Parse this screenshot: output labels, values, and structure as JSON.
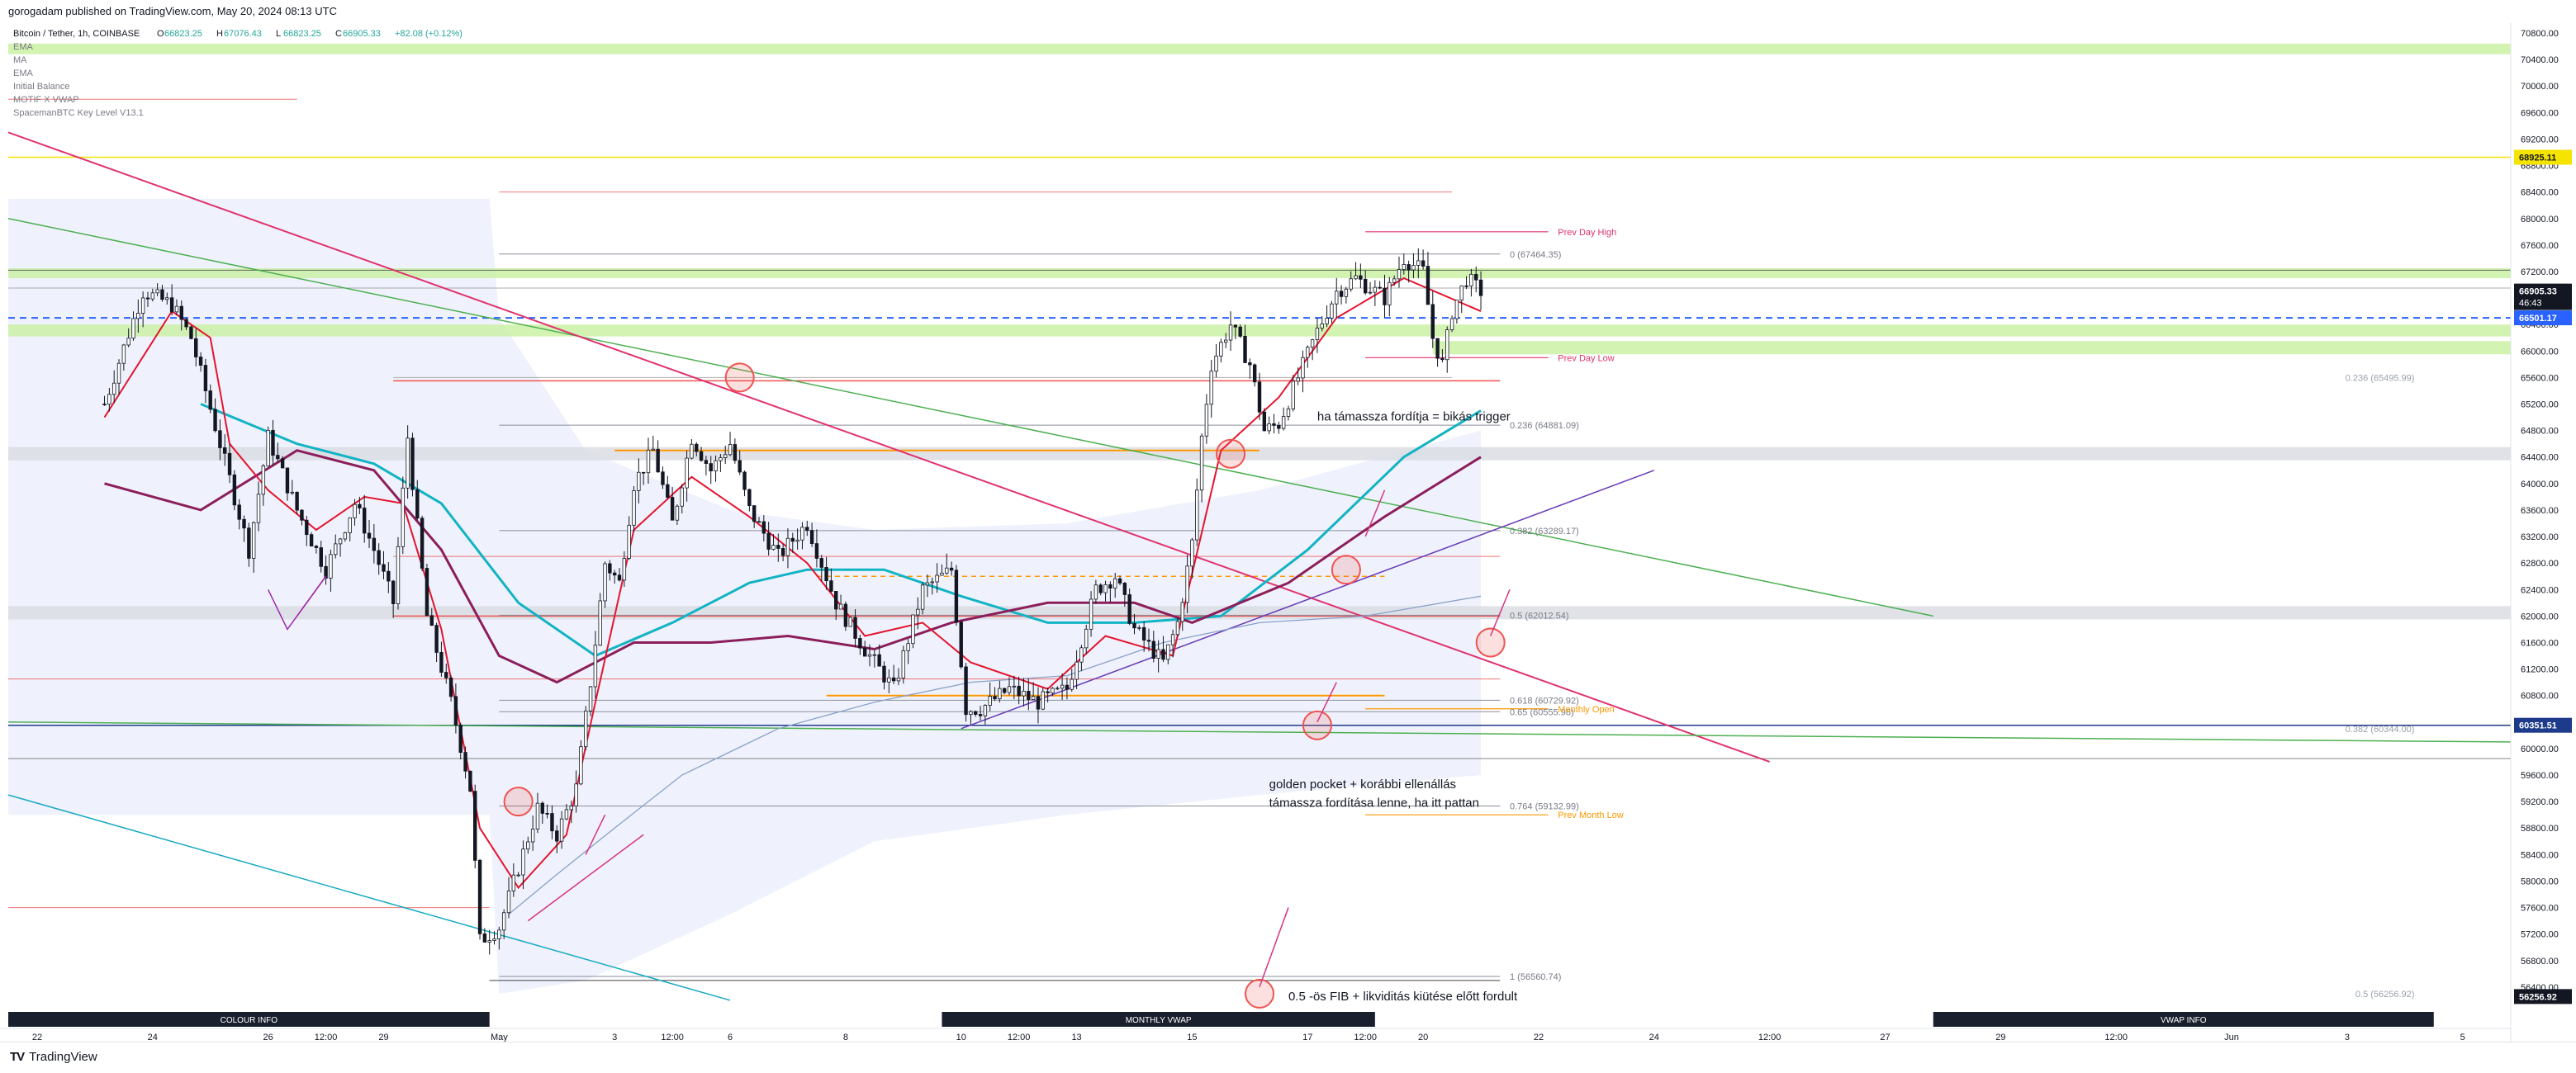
{
  "header": {
    "published": "gorogadam published on TradingView.com, May 20, 2024 08:13 UTC"
  },
  "footer": {
    "logo_glyph": "TV",
    "brand": "TradingView"
  },
  "colors": {
    "up": "#26a69a",
    "down": "#ef5350",
    "ema_red": "#e5132e",
    "ma_purple": "#8b1e5b",
    "cyan": "#12b3c4",
    "green_zone": "#c8f0a0",
    "gray_zone": "#dadde3",
    "pink_trend": "#e0336e",
    "green_trend": "#4caf50",
    "violet_trend": "#673ab7",
    "teal_trend": "#17a9c2",
    "yellow_line": "#f5e300",
    "orange_line": "#ff9800",
    "blue_line": "#1e3a8a",
    "dashed_blue": "#2962ff",
    "vwap_band": "#e9eefb"
  },
  "chart_data": {
    "type": "candlestick",
    "title": "Bitcoin / Tether, 1h, COINBASE",
    "ohlc": {
      "o": "66823.25",
      "h": "67076.43",
      "l": "66823.25",
      "c": "66905.33",
      "chg": "+82.08 (+0.12%)"
    },
    "indicators": [
      "EMA",
      "MA",
      "EMA",
      "Initial Balance",
      "MOTIF X VWAP",
      "SpacemanBTC Key Level V13.1"
    ],
    "y_range": [
      56000,
      70800
    ],
    "y_ticks": [
      "70800.00",
      "70400.00",
      "70000.00",
      "69600.00",
      "69200.00",
      "68800.00",
      "68400.00",
      "68000.00",
      "67600.00",
      "67200.00",
      "66800.00",
      "66400.00",
      "66000.00",
      "65600.00",
      "65200.00",
      "64800.00",
      "64400.00",
      "64000.00",
      "63600.00",
      "63200.00",
      "62800.00",
      "62400.00",
      "62000.00",
      "61600.00",
      "61200.00",
      "60800.00",
      "60400.00",
      "60000.00",
      "59600.00",
      "59200.00",
      "58800.00",
      "58400.00",
      "58000.00",
      "57600.00",
      "57200.00",
      "56800.00",
      "56400.00"
    ],
    "x_ticks": [
      {
        "t": -14,
        "label": "22"
      },
      {
        "t": 10,
        "label": "24"
      },
      {
        "t": 34,
        "label": "26"
      },
      {
        "t": 46,
        "label": "12:00"
      },
      {
        "t": 58,
        "label": "29"
      },
      {
        "t": 82,
        "label": "May"
      },
      {
        "t": 106,
        "label": "3"
      },
      {
        "t": 118,
        "label": "12:00"
      },
      {
        "t": 130,
        "label": "6"
      },
      {
        "t": 154,
        "label": "8"
      },
      {
        "t": 178,
        "label": "10"
      },
      {
        "t": 190,
        "label": "12:00"
      },
      {
        "t": 202,
        "label": "13"
      },
      {
        "t": 226,
        "label": "15"
      },
      {
        "t": 250,
        "label": "17"
      },
      {
        "t": 262,
        "label": "12:00"
      },
      {
        "t": 274,
        "label": "20"
      },
      {
        "t": 298,
        "label": "22"
      },
      {
        "t": 322,
        "label": "24"
      },
      {
        "t": 346,
        "label": "12:00"
      },
      {
        "t": 370,
        "label": "27"
      },
      {
        "t": 394,
        "label": "29"
      },
      {
        "t": 418,
        "label": "12:00"
      },
      {
        "t": 442,
        "label": "Jun"
      },
      {
        "t": 466,
        "label": "3"
      },
      {
        "t": 490,
        "label": "5"
      }
    ],
    "price_path": [
      [
        0,
        65200
      ],
      [
        8,
        66900
      ],
      [
        14,
        66700
      ],
      [
        18,
        66200
      ],
      [
        24,
        64600
      ],
      [
        30,
        63000
      ],
      [
        34,
        64700
      ],
      [
        40,
        63600
      ],
      [
        46,
        62700
      ],
      [
        52,
        63700
      ],
      [
        56,
        63000
      ],
      [
        60,
        62200
      ],
      [
        63,
        64700
      ],
      [
        67,
        62000
      ],
      [
        72,
        60700
      ],
      [
        76,
        59400
      ],
      [
        78,
        57100
      ],
      [
        82,
        57300
      ],
      [
        86,
        58200
      ],
      [
        90,
        59100
      ],
      [
        94,
        58700
      ],
      [
        98,
        59400
      ],
      [
        101,
        61000
      ],
      [
        104,
        62800
      ],
      [
        107,
        62500
      ],
      [
        110,
        64000
      ],
      [
        114,
        64500
      ],
      [
        118,
        63400
      ],
      [
        122,
        64700
      ],
      [
        126,
        64200
      ],
      [
        130,
        64600
      ],
      [
        134,
        63600
      ],
      [
        140,
        62900
      ],
      [
        146,
        63400
      ],
      [
        152,
        62200
      ],
      [
        158,
        61500
      ],
      [
        164,
        60900
      ],
      [
        170,
        62400
      ],
      [
        176,
        62700
      ],
      [
        179,
        60600
      ],
      [
        182,
        60600
      ],
      [
        188,
        60900
      ],
      [
        194,
        60700
      ],
      [
        200,
        60900
      ],
      [
        206,
        62400
      ],
      [
        210,
        62600
      ],
      [
        214,
        61800
      ],
      [
        220,
        61300
      ],
      [
        223,
        61900
      ],
      [
        226,
        63100
      ],
      [
        228,
        64700
      ],
      [
        230,
        65800
      ],
      [
        234,
        66400
      ],
      [
        238,
        65800
      ],
      [
        241,
        64800
      ],
      [
        244,
        64900
      ],
      [
        248,
        65600
      ],
      [
        252,
        66300
      ],
      [
        256,
        66900
      ],
      [
        260,
        67100
      ],
      [
        266,
        66800
      ],
      [
        270,
        67400
      ],
      [
        274,
        67200
      ],
      [
        276,
        66200
      ],
      [
        278,
        65800
      ],
      [
        280,
        66600
      ],
      [
        283,
        67100
      ],
      [
        286,
        66900
      ]
    ],
    "ema_red": [
      [
        0,
        65000
      ],
      [
        14,
        66600
      ],
      [
        22,
        66200
      ],
      [
        26,
        64600
      ],
      [
        34,
        63900
      ],
      [
        44,
        63300
      ],
      [
        54,
        63800
      ],
      [
        62,
        63700
      ],
      [
        70,
        61800
      ],
      [
        78,
        58800
      ],
      [
        86,
        57900
      ],
      [
        96,
        58700
      ],
      [
        102,
        60700
      ],
      [
        110,
        63300
      ],
      [
        122,
        64100
      ],
      [
        134,
        63500
      ],
      [
        146,
        62800
      ],
      [
        158,
        61700
      ],
      [
        170,
        61900
      ],
      [
        180,
        61300
      ],
      [
        196,
        60900
      ],
      [
        208,
        61700
      ],
      [
        222,
        61400
      ],
      [
        232,
        64500
      ],
      [
        244,
        65300
      ],
      [
        256,
        66500
      ],
      [
        270,
        67100
      ],
      [
        286,
        66600
      ]
    ],
    "ma_purple": [
      [
        0,
        64000
      ],
      [
        20,
        63600
      ],
      [
        40,
        64500
      ],
      [
        56,
        64200
      ],
      [
        70,
        63000
      ],
      [
        82,
        61400
      ],
      [
        94,
        61000
      ],
      [
        110,
        61600
      ],
      [
        126,
        61600
      ],
      [
        142,
        61700
      ],
      [
        160,
        61500
      ],
      [
        176,
        61900
      ],
      [
        196,
        62200
      ],
      [
        214,
        62200
      ],
      [
        226,
        61900
      ],
      [
        246,
        62500
      ],
      [
        266,
        63500
      ],
      [
        286,
        64400
      ]
    ],
    "cyan_ma": [
      [
        20,
        65200
      ],
      [
        40,
        64600
      ],
      [
        56,
        64300
      ],
      [
        70,
        63700
      ],
      [
        86,
        62200
      ],
      [
        102,
        61400
      ],
      [
        118,
        61900
      ],
      [
        134,
        62500
      ],
      [
        146,
        62700
      ],
      [
        162,
        62700
      ],
      [
        178,
        62300
      ],
      [
        196,
        61900
      ],
      [
        214,
        61900
      ],
      [
        232,
        62000
      ],
      [
        250,
        63000
      ],
      [
        270,
        64400
      ],
      [
        286,
        65100
      ]
    ],
    "vwap_line": [
      [
        84,
        57500
      ],
      [
        94,
        58100
      ],
      [
        106,
        58800
      ],
      [
        120,
        59600
      ],
      [
        140,
        60300
      ],
      [
        160,
        60700
      ],
      [
        180,
        61000
      ],
      [
        200,
        61100
      ],
      [
        220,
        61600
      ],
      [
        240,
        61900
      ],
      [
        262,
        62000
      ],
      [
        286,
        62300
      ]
    ],
    "horizontal_levels": [
      {
        "price": 68925.11,
        "label": "68925.11",
        "color": "#f5e300"
      },
      {
        "price": 66501.17,
        "label": "66501.17",
        "color": "#2962ff",
        "dashed": true
      },
      {
        "price": 60351.51,
        "label": "60351.51",
        "color": "#1e3a8a"
      },
      {
        "price": 62000,
        "label": "",
        "color": "#ef5350"
      },
      {
        "price": 65550,
        "label": "",
        "color": "#ef5350"
      }
    ],
    "fib_levels": [
      {
        "price": 67464.35,
        "label": "0 (67464.35)"
      },
      {
        "price": 64881.09,
        "label": "0.236 (64881.09)"
      },
      {
        "price": 63289.17,
        "label": "0.382 (63289.17)"
      },
      {
        "price": 62012.54,
        "label": "0.5 (62012.54)"
      },
      {
        "price": 60729.02,
        "label": "0.618 (60729.92)"
      },
      {
        "price": 60555.98,
        "label": "0.65 (60555.98)"
      },
      {
        "price": 59132.99,
        "label": "0.764 (59132.99)"
      },
      {
        "price": 56560.74,
        "label": "1 (56560.74)"
      }
    ],
    "key_levels": [
      {
        "price": 67800,
        "label": "Prev Day High",
        "color": "#e0336e"
      },
      {
        "price": 65900,
        "label": "Prev Day Low",
        "color": "#e0336e"
      },
      {
        "price": 60600,
        "label": "Monthly Open",
        "color": "#ff9800"
      },
      {
        "price": 59000,
        "label": "Prev Month Low",
        "color": "#ff9800"
      }
    ],
    "right_fib_labels": [
      {
        "price": 65600,
        "label": "0.236 (65495.99)"
      },
      {
        "price": 60300,
        "label": "0.382 (60344.00)"
      },
      {
        "price": 56300,
        "label": "0.5 (56256.92)"
      }
    ],
    "axis_badges": [
      {
        "price": 66905.33,
        "label": "66905.33",
        "sub": "46:43",
        "bg": "#131722"
      },
      {
        "price": 56256.92,
        "label": "56256.92",
        "sub": "",
        "bg": "#131722"
      }
    ],
    "annotations": [
      {
        "text": "ha támassza fordítja = bikás trigger",
        "t": 252,
        "price": 64950
      },
      {
        "text": "golden pocket + korábbi ellenállás",
        "t": 242,
        "price": 59400
      },
      {
        "text": "támassza fordítása lenne, ha itt pattan",
        "t": 242,
        "price": 59120
      },
      {
        "text": "0.5 -ös FIB + likviditás kiütése előtt fordult",
        "t": 246,
        "price": 56200
      }
    ],
    "bottom_labels": [
      {
        "label": "COLOUR INFO",
        "t0": -20,
        "t1": 80
      },
      {
        "label": "MONTHLY VWAP",
        "t0": 174,
        "t1": 264
      },
      {
        "label": "VWAP INFO",
        "t0": 380,
        "t1": 484
      }
    ]
  }
}
